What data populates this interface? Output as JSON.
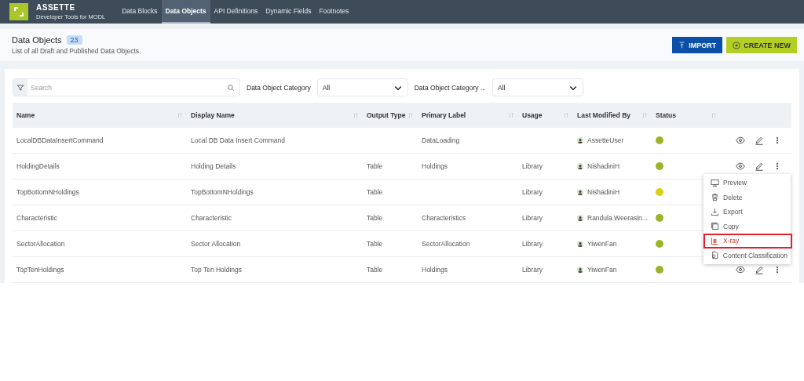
{
  "app": {
    "name": "ASSETTE",
    "subtitle": "Developer Tools for MODL"
  },
  "nav": [
    {
      "label": "Data Blocks",
      "selected": false
    },
    {
      "label": "Data Objects",
      "selected": true
    },
    {
      "label": "API Definitions",
      "selected": false
    },
    {
      "label": "Dynamic Fields",
      "selected": false
    },
    {
      "label": "Footnotes",
      "selected": false
    }
  ],
  "header": {
    "title": "Data Objects",
    "count": "23",
    "description": "List of all Draft and Published Data Objects.",
    "buttons": [
      {
        "label": "IMPORT",
        "kind": "import"
      },
      {
        "label": "CREATE NEW",
        "kind": "create"
      }
    ]
  },
  "filters": {
    "search": {
      "placeholder": "Search"
    },
    "selects": [
      {
        "label": "Data Object Category",
        "value": "All"
      },
      {
        "label": "Data Object Category ...",
        "value": "All"
      }
    ]
  },
  "table": {
    "columns": [
      "Name",
      "Display Name",
      "Output Type",
      "Primary Label",
      "Usage",
      "Last Modified By",
      "Status"
    ],
    "rows": [
      {
        "cells": [
          "LocalDBDataInsertCommand",
          "Local DB Data Insert Command",
          "",
          "DataLoading",
          "",
          "AssetteUser"
        ],
        "color": "#9ab52a",
        "actions_shown": true
      },
      {
        "cells": [
          "HoldingDetails",
          "Holding Details",
          "Table",
          "Holdings",
          "Library",
          "NishadiniH"
        ],
        "color": "#9ab52a",
        "actions_shown": true
      },
      {
        "cells": [
          "TopBottomNHoldings",
          "TopBottomNHoldings",
          "Table",
          "",
          "Library",
          "NishadiniH"
        ],
        "color": "#d9cf16",
        "actions_shown": false
      },
      {
        "cells": [
          "Characteristic",
          "Characteristic",
          "Table",
          "Characteristics",
          "Library",
          "Randula.Weerasin..."
        ],
        "color": "#9ab52a",
        "actions_shown": false
      },
      {
        "cells": [
          "SectorAllocation",
          "Sector Allocation",
          "Table",
          "SectorAllocation",
          "Library",
          "YiwenFan"
        ],
        "color": "#9ab52a",
        "actions_shown": false
      },
      {
        "cells": [
          "TopTenHoldings",
          "Top Ten Holdings",
          "Table",
          "Holdings",
          "Library",
          "YiwenFan"
        ],
        "color": "#9ab52a",
        "actions_shown": true
      }
    ]
  },
  "context_menu": [
    {
      "label": "Preview",
      "kind": "preview",
      "selected": false
    },
    {
      "label": "Delete",
      "kind": "delete",
      "selected": false
    },
    {
      "label": "Export",
      "kind": "export",
      "selected": false
    },
    {
      "label": "Copy",
      "kind": "copy",
      "selected": false
    },
    {
      "label": "X-ray",
      "kind": "xray",
      "selected": true
    },
    {
      "label": "Content Classification",
      "kind": "classify",
      "selected": false
    }
  ]
}
